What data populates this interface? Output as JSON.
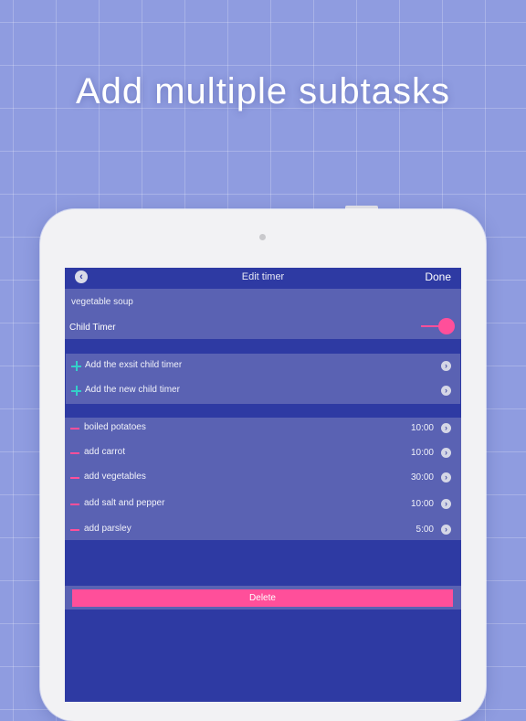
{
  "headline": "Add multiple subtasks",
  "nav": {
    "back_icon": "chevron-left-icon",
    "title": "Edit timer",
    "done_label": "Done"
  },
  "timer": {
    "name": "vegetable soup",
    "child_timer_label": "Child Timer",
    "child_timer_enabled": true
  },
  "add_options": [
    {
      "label": "Add the exsit child timer",
      "icon": "plus-icon"
    },
    {
      "label": "Add the new child timer",
      "icon": "plus-icon"
    }
  ],
  "subtasks": [
    {
      "label": "boiled potatoes",
      "time": "10:00"
    },
    {
      "label": "add carrot",
      "time": "10:00"
    },
    {
      "label": "add vegetables",
      "time": "30:00"
    },
    {
      "label": "add salt and pepper",
      "time": "10:00"
    },
    {
      "label": "add parsley",
      "time": "5:00"
    }
  ],
  "delete_label": "Delete",
  "colors": {
    "background": "#8f9ce0",
    "navbar": "#2e3aa3",
    "cell": "#5a62b3",
    "accent_pink": "#ff4f9a",
    "accent_teal": "#33d0c9"
  }
}
